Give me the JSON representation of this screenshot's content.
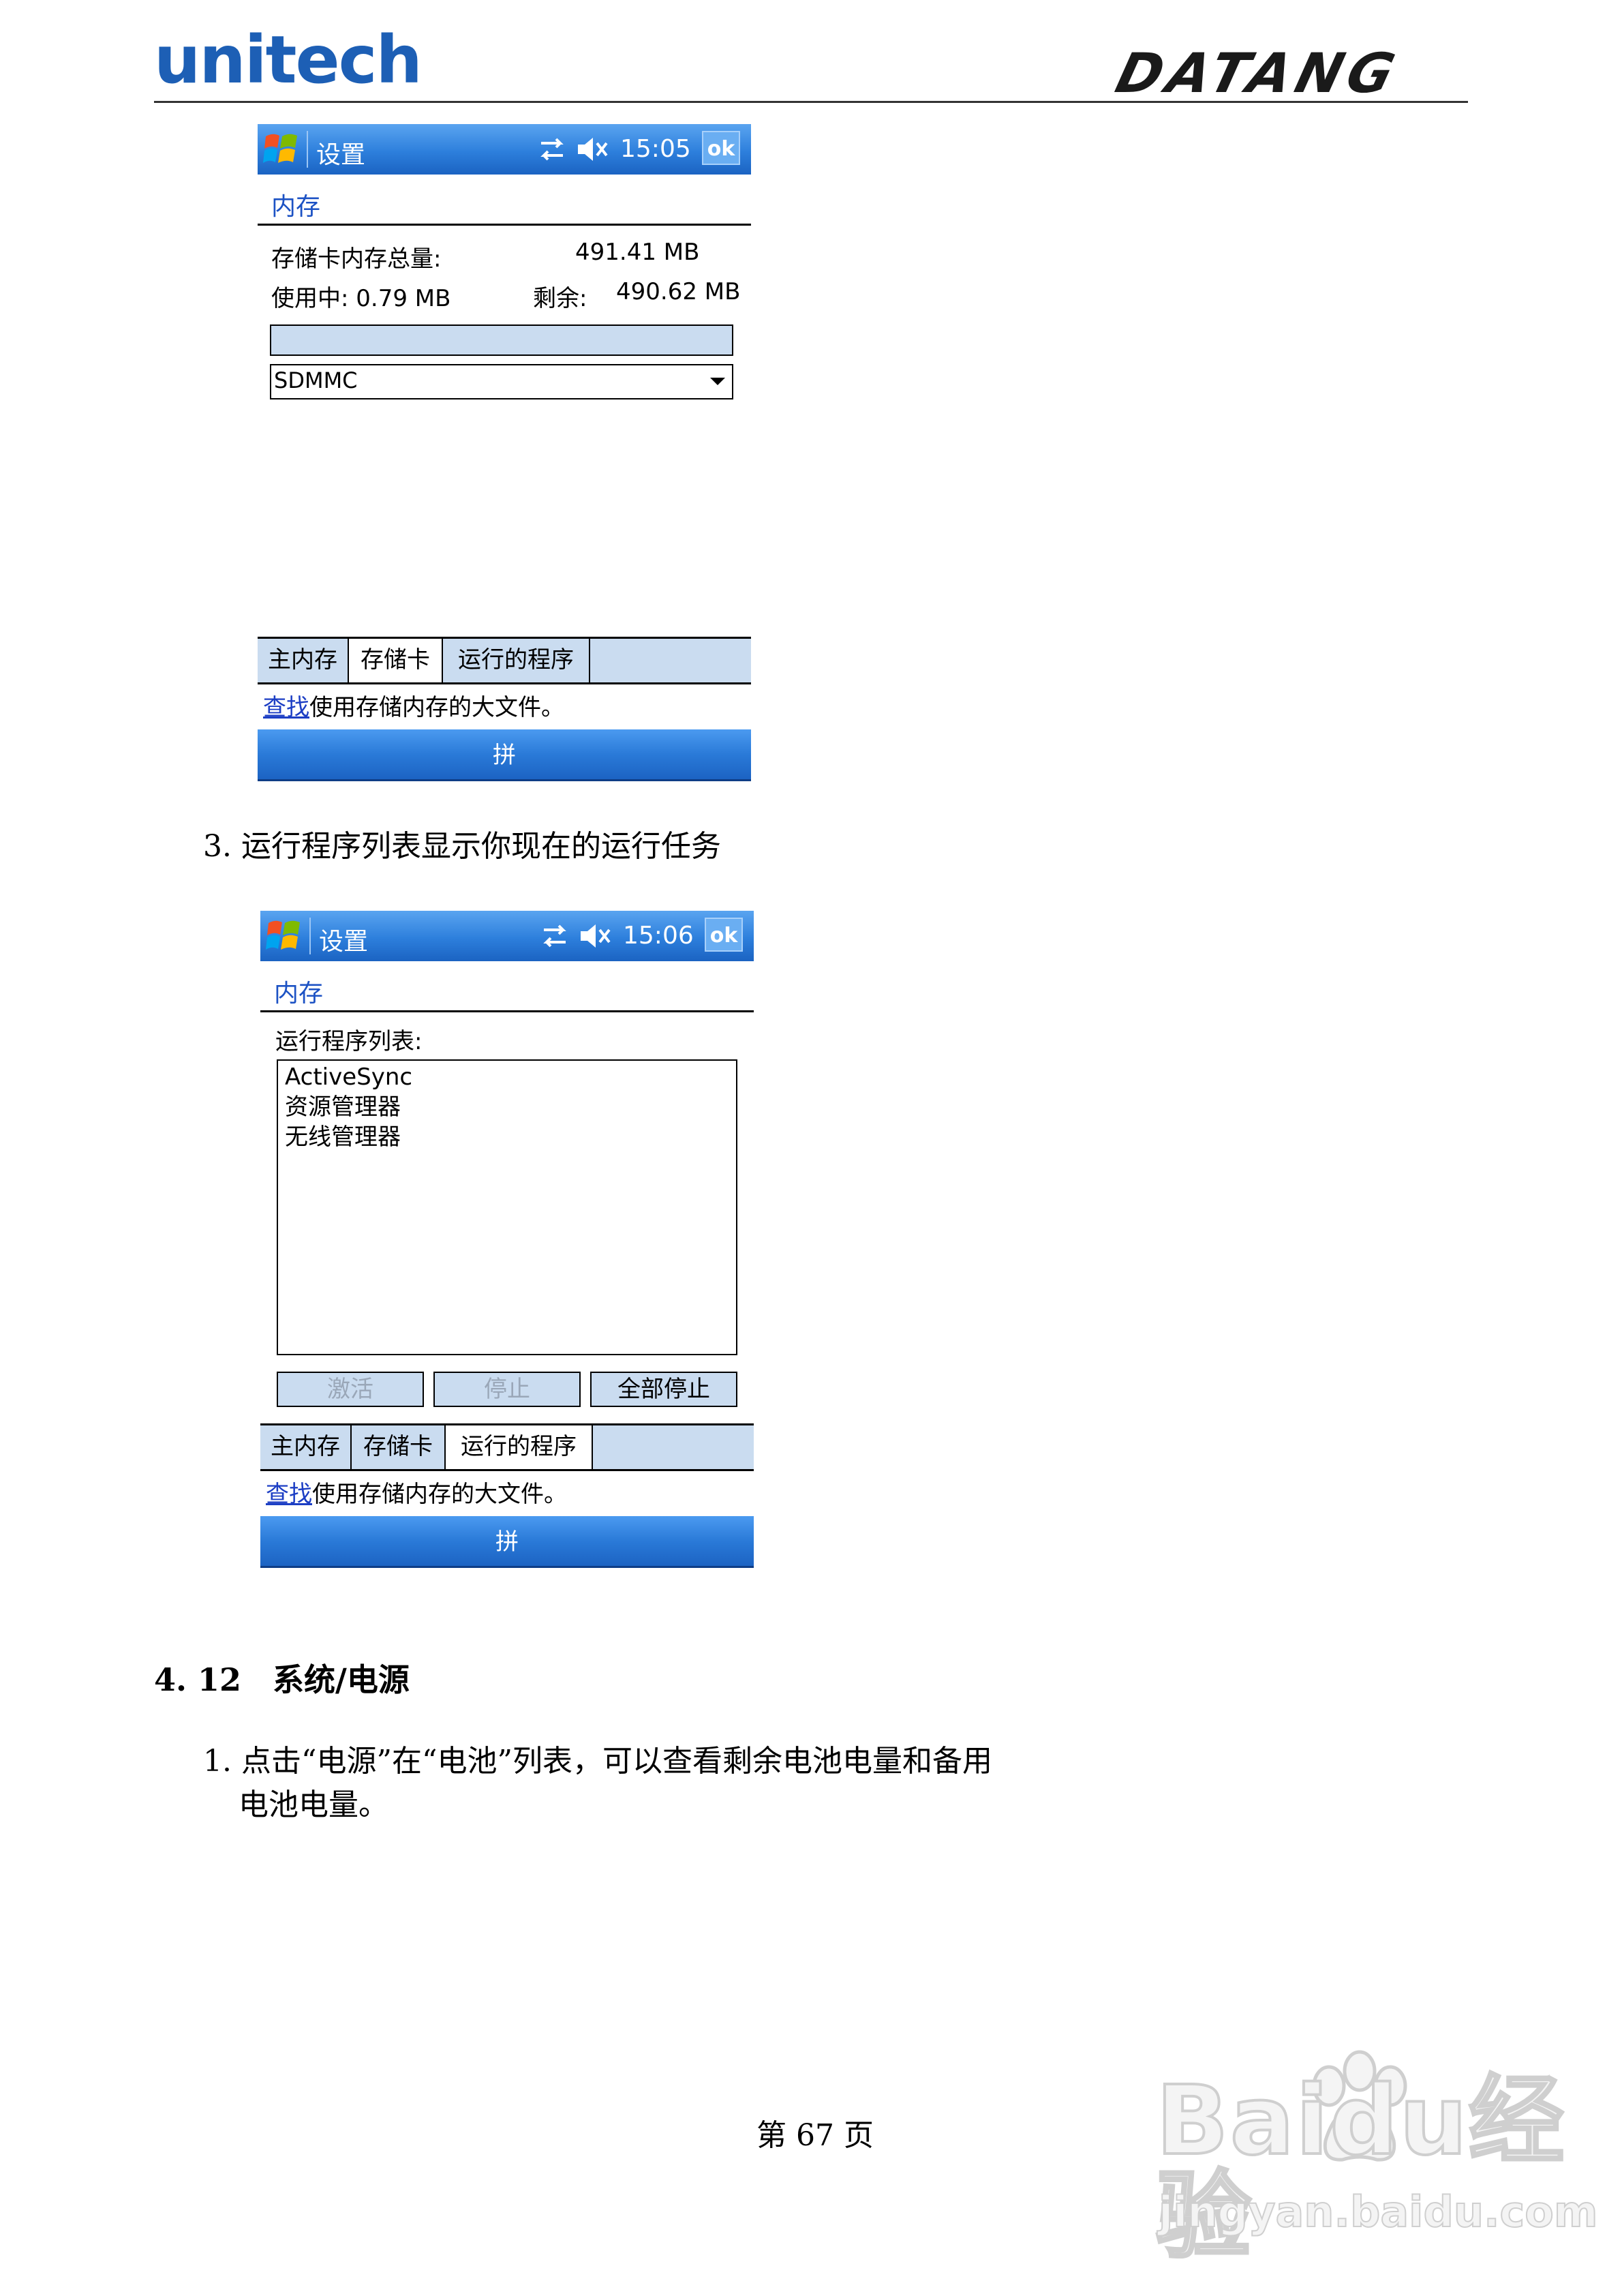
{
  "header": {
    "logo_left": "unitech",
    "logo_right": "DATANG"
  },
  "screen1": {
    "titlebar": {
      "title": "设置",
      "time": "15:05",
      "ok_label": "ok"
    },
    "section_title": "内存",
    "storage_total_label": "存储卡内存总量:",
    "storage_total_value": "491.41 MB",
    "in_use_label": "使用中:",
    "in_use_value": "0.79 MB",
    "free_label": "剩余:",
    "free_value": "490.62 MB",
    "usage_fraction": 0.0,
    "card_select_value": "SDMMC",
    "tabs": [
      "主内存",
      "存储卡",
      "运行的程序"
    ],
    "active_tab": 1,
    "hint_link": "查找",
    "hint_text": "使用存储内存的大文件。",
    "menu_label": "拼"
  },
  "step3_text": "3. 运行程序列表显示你现在的运行任务",
  "screen2": {
    "titlebar": {
      "title": "设置",
      "time": "15:06",
      "ok_label": "ok"
    },
    "section_title": "内存",
    "list_label": "运行程序列表:",
    "programs": [
      "ActiveSync",
      "资源管理器",
      "无线管理器"
    ],
    "buttons": {
      "activate": "激活",
      "stop": "停止",
      "stop_all": "全部停止"
    },
    "tabs": [
      "主内存",
      "存储卡",
      "运行的程序"
    ],
    "active_tab": 2,
    "hint_link": "查找",
    "hint_text": "使用存储内存的大文件。",
    "menu_label": "拼"
  },
  "section_heading": "4. 12　系统/电源",
  "step1_line1": "1. 点击“电源”在“电池”列表，可以查看剩余电池电量和备用",
  "step1_line2": "电池电量。",
  "footer_page": "第 67 页",
  "watermark": {
    "brand": "Baidu经验",
    "url": "jingyan.baidu.com"
  },
  "colors": {
    "title_blue": "#2d7fdc",
    "tab_fill": "#cadcf0",
    "link_blue": "#1c3ec4",
    "logo_blue": "#1d5fb5"
  },
  "icons": [
    "windows-start-icon",
    "connectivity-icon",
    "speaker-muted-icon",
    "dropdown-arrow-icon",
    "baidu-paw-icon"
  ]
}
